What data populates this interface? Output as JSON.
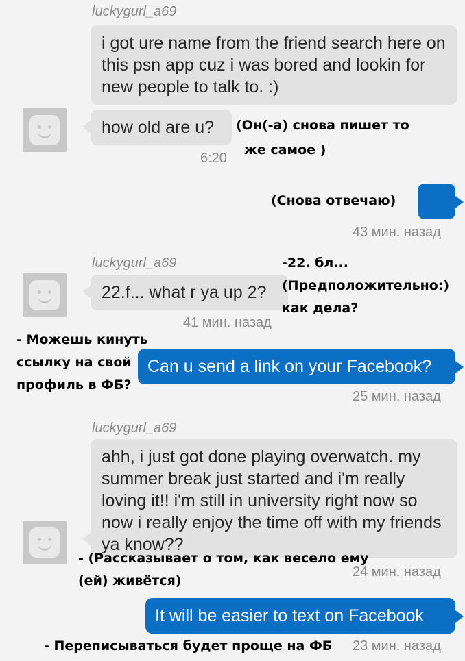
{
  "messages": [
    {
      "sender": "luckygurl_a69",
      "text": "i got ure name from the friend search here on this psn app cuz i was bored and lookin for new people to talk to. :)"
    },
    {
      "text": "how old are u?",
      "time": "6:20"
    },
    {
      "text": "",
      "time": "43 мин. назад"
    },
    {
      "sender": "luckygurl_a69",
      "text": "22.f... what r ya up 2?",
      "time": "41 мин. назад"
    },
    {
      "text": "Can u send a link on your Facebook?",
      "time": "25 мин. назад"
    },
    {
      "sender": "luckygurl_a69",
      "text": "ahh, i just got done playing overwatch. my summer break just started and i'm really loving it!! i'm still in university right now so now i really enjoy the time off with my friends ya know??",
      "time": "24 мин. назад"
    },
    {
      "text": "It will be easier to text on Facebook",
      "time": "23 мин. назад"
    }
  ],
  "annotations": {
    "a1_line1": "(Он(-а) снова пишет то",
    "a1_line2": "же самое )",
    "a2": "(Снова отвечаю)",
    "a3_line1": "-22. бл...",
    "a3_line2": "(Предположительно:)",
    "a3_line3": "как дела?",
    "a4_line1": "- Можешь кинуть",
    "a4_line2": "ссылку на свой",
    "a4_line3": "профиль в ФБ?",
    "a5_line1": "- (Рассказывает о том, как весело ему",
    "a5_line2": "(ей) живётся)",
    "a6": "- Переписываться будет проще на ФБ"
  },
  "colors": {
    "incoming_bubble": "#e2e2e2",
    "outgoing_bubble": "#0b6fc4",
    "background": "#f3f3f3"
  },
  "icons": {
    "avatar": "smiley-avatar-icon"
  }
}
